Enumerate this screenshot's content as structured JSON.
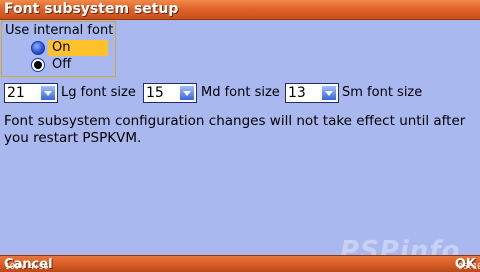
{
  "title": "Font subsystem setup",
  "internal_font": {
    "legend": "Use internal font",
    "options": [
      {
        "label": "On",
        "selected": false,
        "focused": true
      },
      {
        "label": "Off",
        "selected": true,
        "focused": false
      }
    ]
  },
  "fonts": {
    "lg": {
      "value": "21",
      "label": "Lg font size"
    },
    "md": {
      "value": "15",
      "label": "Md font size"
    },
    "sm": {
      "value": "13",
      "label": "Sm font size"
    }
  },
  "message": "Font subsystem configuration changes will not take effect until after you restart PSPKVM.",
  "softkeys": {
    "left": "Cancel",
    "right": "OK"
  },
  "status": {
    "battery": "100% 4:56",
    "clock": "06:10"
  },
  "watermark": "PSPinfo",
  "colors": {
    "background": "#a9b8ee",
    "title_bar": "#e0642a",
    "highlight": "#ffc22a",
    "group_border": "#d4a532"
  }
}
